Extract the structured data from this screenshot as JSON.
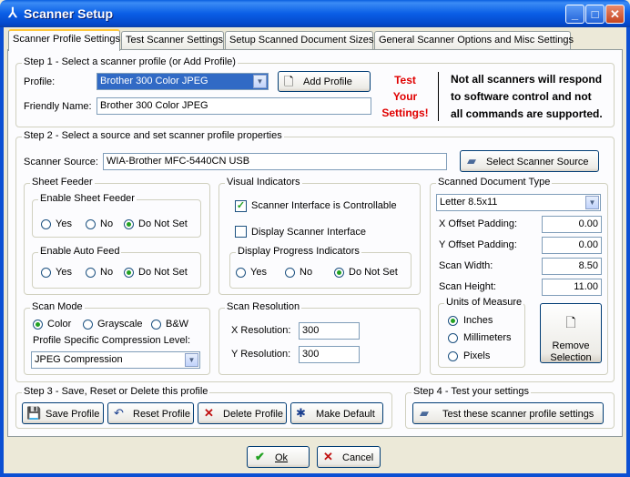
{
  "window": {
    "title": "Scanner Setup",
    "minimize": "_",
    "maximize": "□",
    "close": "✕"
  },
  "tabs": [
    "Scanner Profile Settings",
    "Test Scanner Settings",
    "Setup Scanned Document Sizes",
    "General Scanner Options and Misc Settings"
  ],
  "step1": {
    "legend": "Step 1 - Select a scanner profile (or Add Profile)",
    "profile_label": "Profile:",
    "profile_value": "Brother 300 Color JPEG",
    "add_profile": "Add Profile",
    "friendly_label": "Friendly Name:",
    "friendly_value": "Brother 300 Color JPEG",
    "test_line1": "Test",
    "test_line2": "Your",
    "test_line3": "Settings!",
    "note_line1": "Not all scanners will respond",
    "note_line2": "to software control and not",
    "note_line3": "all commands are supported."
  },
  "step2": {
    "legend": "Step 2 - Select a source and set scanner profile properties",
    "source_label": "Scanner Source:",
    "source_value": "WIA-Brother MFC-5440CN USB",
    "select_source": "Select Scanner Source",
    "sheet_feeder": {
      "legend": "Sheet Feeder",
      "enable_sheet_feeder": "Enable Sheet Feeder",
      "enable_auto_feed": "Enable Auto Feed",
      "yes": "Yes",
      "no": "No",
      "not_set": "Do Not Set"
    },
    "visual": {
      "legend": "Visual Indicators",
      "controllable": "Scanner Interface is Controllable",
      "display_interface": "Display Scanner Interface",
      "progress_legend": "Display Progress Indicators",
      "yes": "Yes",
      "no": "No",
      "not_set": "Do Not Set"
    },
    "scan_mode": {
      "legend": "Scan Mode",
      "color": "Color",
      "grayscale": "Grayscale",
      "bw": "B&W",
      "compression_label": "Profile Specific Compression Level:",
      "compression_value": "JPEG Compression"
    },
    "resolution": {
      "legend": "Scan Resolution",
      "x_label": "X Resolution:",
      "x_value": "300",
      "y_label": "Y Resolution:",
      "y_value": "300"
    },
    "doc_type": {
      "legend": "Scanned Document Type",
      "type_value": "Letter 8.5x11",
      "x_offset_label": "X Offset Padding:",
      "x_offset_value": "0.00",
      "y_offset_label": "Y Offset Padding:",
      "y_offset_value": "0.00",
      "width_label": "Scan Width:",
      "width_value": "8.50",
      "height_label": "Scan Height:",
      "height_value": "11.00",
      "units_legend": "Units of Measure",
      "inches": "Inches",
      "millimeters": "Millimeters",
      "pixels": "Pixels",
      "remove_line1": "Remove",
      "remove_line2": "Selection"
    }
  },
  "step3": {
    "legend": "Step 3 - Save, Reset or Delete this profile",
    "save": "Save Profile",
    "reset": "Reset Profile",
    "delete": "Delete Profile",
    "default": "Make Default"
  },
  "step4": {
    "legend": "Step 4 - Test your settings",
    "test": "Test these scanner profile settings"
  },
  "footer": {
    "ok": "Ok",
    "cancel": "Cancel"
  },
  "colors": {
    "title_bar": "#0a5ee6",
    "warning_red": "#e00000",
    "check_green": "#21a121"
  }
}
